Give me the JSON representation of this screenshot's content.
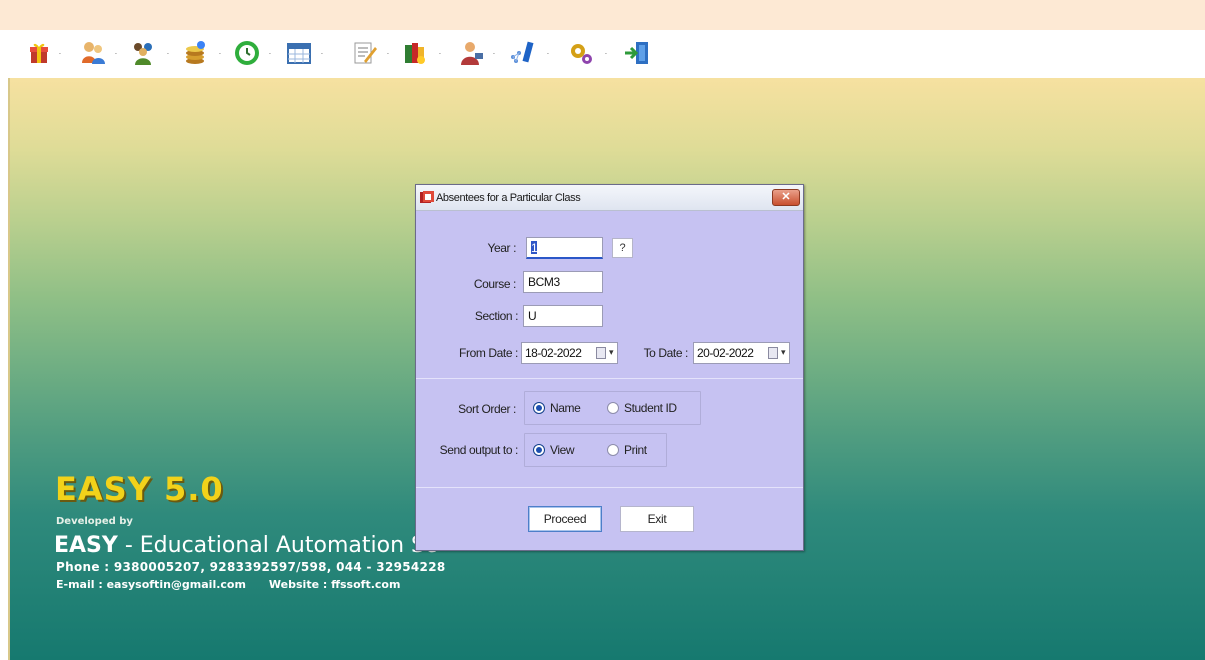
{
  "toolbar": {
    "items": [
      {
        "icon": "gift-icon"
      },
      {
        "icon": "users-icon"
      },
      {
        "icon": "group-icon"
      },
      {
        "icon": "coins-icon"
      },
      {
        "icon": "clock-icon"
      },
      {
        "icon": "calendar-grid-icon"
      },
      {
        "icon": "notepad-icon"
      },
      {
        "icon": "books-icon"
      },
      {
        "icon": "person-tools-icon"
      },
      {
        "icon": "network-icon"
      },
      {
        "icon": "gears-icon"
      },
      {
        "icon": "exit-door-icon"
      }
    ]
  },
  "brand": {
    "title": "EASY 5.0",
    "developed_by": "Developed by",
    "name_bold": "EASY",
    "name_rest": " - Educational Automation Sc",
    "phone": "Phone : 9380005207, 9283392597/598,  044 - 32954228",
    "email": "E-mail : easysoftin@gmail.com",
    "website": "Website : ffssoft.com"
  },
  "dialog": {
    "title": "Absentees for a Particular Class",
    "close_label": "✕",
    "year_label": "Year :",
    "year_value": "1",
    "help_label": "?",
    "course_label": "Course :",
    "course_value": "BCM3",
    "section_label": "Section :",
    "section_value": "U",
    "from_date_label": "From Date :",
    "from_date_value": "18-02-2022",
    "to_date_label": "To Date :",
    "to_date_value": "20-02-2022",
    "sort_order_label": "Sort Order :",
    "sort_options": [
      {
        "label": "Name",
        "selected": true
      },
      {
        "label": "Student ID",
        "selected": false
      }
    ],
    "output_label": "Send output to :",
    "output_options": [
      {
        "label": "View",
        "selected": true
      },
      {
        "label": "Print",
        "selected": false
      }
    ],
    "proceed_label": "Proceed",
    "exit_label": "Exit"
  },
  "colors": {
    "dialog_bg": "#c6c2f2",
    "brand_yellow": "#f2d21a",
    "top_strip": "#fde9d4"
  }
}
